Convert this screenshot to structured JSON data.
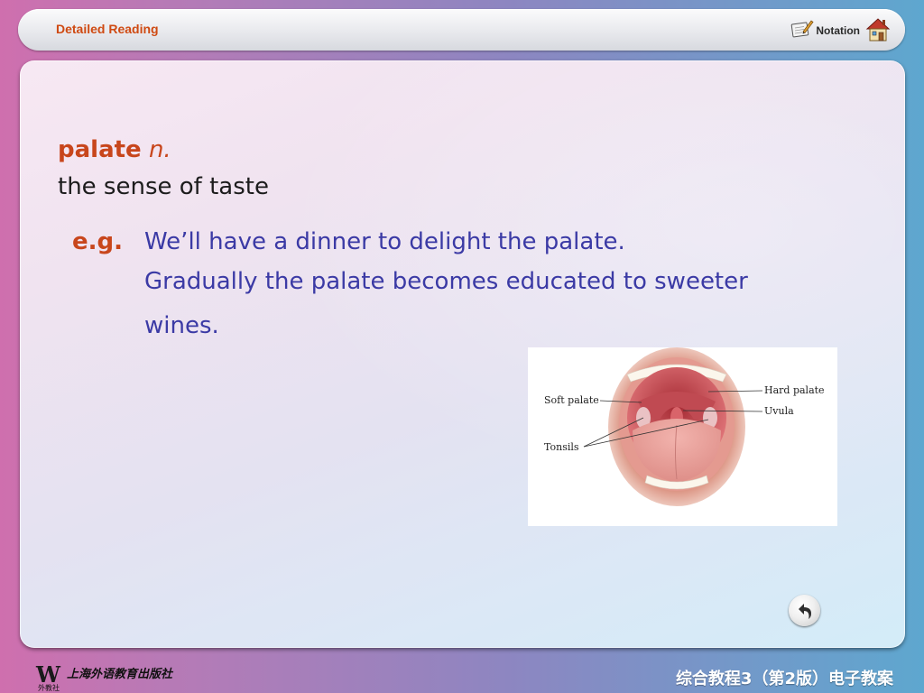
{
  "header": {
    "title": "Detailed Reading",
    "notation_label": "Notation"
  },
  "entry": {
    "headword": "palate",
    "part_of_speech": "n.",
    "definition": "the sense of taste",
    "eg_label": "e.g.",
    "examples": [
      "We’ll have a dinner to delight the palate.",
      "Gradually the palate becomes educated to sweeter",
      "wines."
    ]
  },
  "illustration": {
    "labels": {
      "soft_palate": "Soft palate",
      "tonsils": "Tonsils",
      "hard_palate": "Hard palate",
      "uvula": "Uvula"
    }
  },
  "footer": {
    "logo_w": "W",
    "logo_cn": "上海外语教育出版社",
    "logo_small": "外教社",
    "course": "综合教程3（第2版）电子教案"
  },
  "colors": {
    "accent_orange": "#c8461c",
    "example_blue": "#3b3aa5",
    "header_title": "#cf4a12"
  },
  "icons": [
    "notation-icon",
    "home-icon",
    "back-arrow-icon"
  ]
}
